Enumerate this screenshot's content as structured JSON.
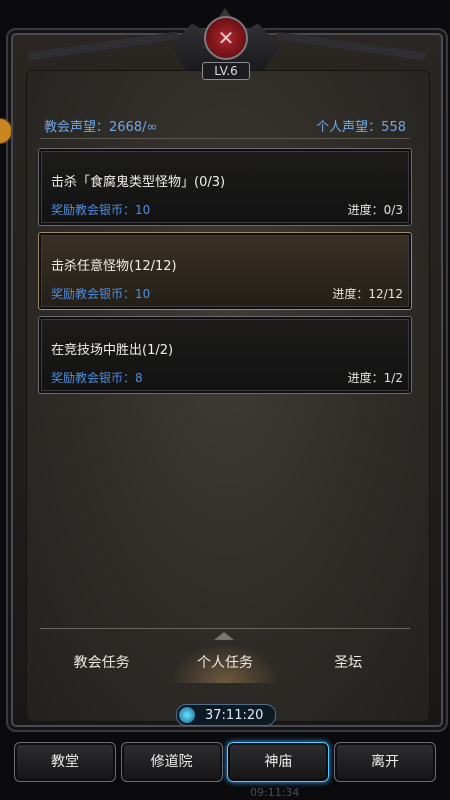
{
  "header": {
    "level_badge": "LV.6",
    "emblem_icon": "church-emblem-icon"
  },
  "reputation": {
    "church_label": "教会声望：2668/∞",
    "personal_label": "个人声望：558"
  },
  "quests": [
    {
      "title": "击杀「食腐鬼类型怪物」(0/3)",
      "reward": "奖励教会银币：10",
      "progress": "进度：0/3",
      "active": false
    },
    {
      "title": "击杀任意怪物(12/12)",
      "reward": "奖励教会银币：10",
      "progress": "进度：12/12",
      "active": true
    },
    {
      "title": "在竞技场中胜出(1/2)",
      "reward": "奖励教会银币：8",
      "progress": "进度：1/2",
      "active": false
    }
  ],
  "tabs": [
    {
      "label": "教会任务",
      "active": false
    },
    {
      "label": "个人任务",
      "active": true
    },
    {
      "label": "圣坛",
      "active": false
    }
  ],
  "timer": {
    "value": "37:11:20"
  },
  "bottom_nav": [
    {
      "label": "教堂",
      "active": false
    },
    {
      "label": "修道院",
      "active": false
    },
    {
      "label": "神庙",
      "active": true
    },
    {
      "label": "离开",
      "active": false
    }
  ],
  "ghost_text": "09:11:34",
  "colors": {
    "reward_blue": "#4c8fe0",
    "reputation_blue": "#6fa6e6",
    "active_glow": "#5bc7ff",
    "emblem_red": "#b0282e"
  }
}
